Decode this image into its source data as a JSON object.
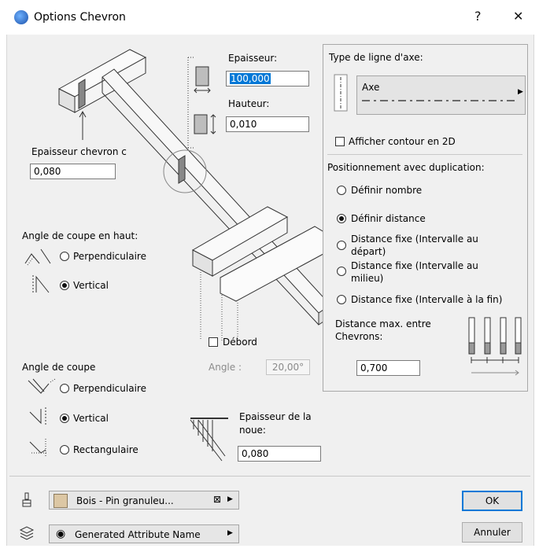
{
  "window": {
    "title": "Options Chevron",
    "help_label": "?",
    "close_label": "✕"
  },
  "beam": {
    "epaisseur_label": "Epaisseur:",
    "epaisseur_value": "100,000",
    "hauteur_label": "Hauteur:",
    "hauteur_value": "0,010",
    "chevron_label": "Epaisseur chevron c",
    "chevron_value": "0,080"
  },
  "top_cut": {
    "title": "Angle de coupe en haut:",
    "options": [
      "Perpendiculaire",
      "Vertical"
    ],
    "selected": "Vertical"
  },
  "debord": {
    "label": "Débord",
    "checked": false,
    "angle_label": "Angle :",
    "angle_value": "20,00°"
  },
  "cut": {
    "title": "Angle de coupe",
    "options": [
      "Perpendiculaire",
      "Vertical",
      "Rectangulaire"
    ],
    "selected": "Vertical"
  },
  "noue": {
    "label_line1": "Epaisseur de la",
    "label_line2": "noue:",
    "value": "0,080"
  },
  "axis_line": {
    "title": "Type de ligne d'axe:",
    "line_name": "Axe",
    "show_contour_label": "Afficher contour en 2D",
    "show_contour_checked": false
  },
  "positioning": {
    "title": "Positionnement avec duplication:",
    "options": [
      {
        "line1": "Définir nombre",
        "line2": ""
      },
      {
        "line1": "Définir distance",
        "line2": ""
      },
      {
        "line1": "Distance fixe (Intervalle au",
        "line2": "départ)"
      },
      {
        "line1": "Distance fixe (Intervalle au",
        "line2": "milieu)"
      },
      {
        "line1": "Distance fixe (Intervalle à la fin)",
        "line2": ""
      }
    ],
    "selected_index": 1,
    "max_dist_line1": "Distance max. entre",
    "max_dist_line2": "Chevrons:",
    "max_dist_value": "0,700"
  },
  "material": {
    "name": "Bois - Pin granuleu...",
    "swatch_color": "#dcc7a4"
  },
  "layer": {
    "name": "Generated Attribute Name"
  },
  "buttons": {
    "ok": "OK",
    "cancel": "Annuler"
  },
  "colors": {
    "selection": "#0078d7",
    "dialog_bg": "#f0f0f0"
  }
}
